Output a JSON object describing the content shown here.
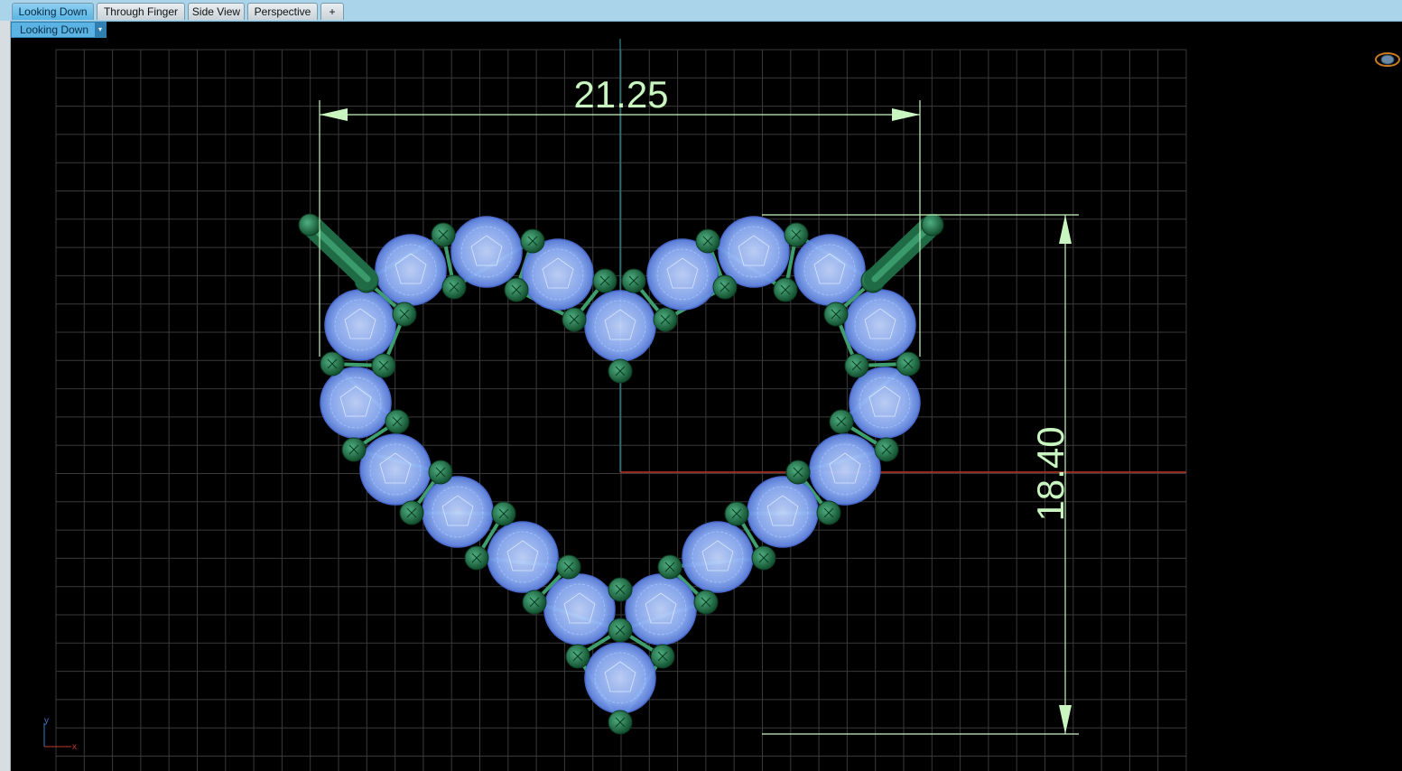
{
  "tabs": [
    {
      "label": "Looking Down",
      "active": true
    },
    {
      "label": "Through Finger",
      "active": false
    },
    {
      "label": "Side View",
      "active": false
    },
    {
      "label": "Perspective",
      "active": false
    }
  ],
  "add_tab_symbol": "+",
  "viewport": {
    "label": "Looking Down",
    "dropdown_arrow": "▾",
    "dimension_width": "21.25",
    "dimension_height": "18.40",
    "axis_x": "x",
    "axis_y": "y"
  },
  "colors": {
    "grid": "#3a3a3a",
    "axis_x": "#c0392b",
    "axis_y": "#2a8a8a",
    "dimension": "#c8f5c0",
    "gem": "#8fb4ff",
    "prong": "#2e7d55"
  }
}
